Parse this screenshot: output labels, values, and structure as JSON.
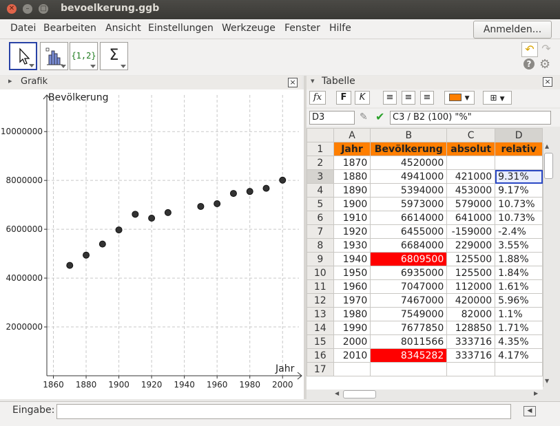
{
  "window": {
    "title": "bevoelkerung.ggb"
  },
  "menu": [
    "Datei",
    "Bearbeiten",
    "Ansicht",
    "Einstellungen",
    "Werkzeuge",
    "Fenster",
    "Hilfe"
  ],
  "login_label": "Anmelden...",
  "toolbar": {
    "list_tool_label": "{1,2}",
    "sum_tool_label": "Σ"
  },
  "graphics_panel": {
    "title": "Grafik"
  },
  "spreadsheet_panel": {
    "title": "Tabelle",
    "fx_label": "fx",
    "bold_label": "F",
    "italic_label": "K",
    "cell_name": "D3",
    "formula": "C3 / B2 (100) \"%\"",
    "columns": [
      "A",
      "B",
      "C",
      "D"
    ],
    "rows": [
      [
        "1",
        "Jahr",
        "Bevölkerung",
        "absolut",
        "relativ"
      ],
      [
        "2",
        "1870",
        "4520000",
        "",
        ""
      ],
      [
        "3",
        "1880",
        "4941000",
        "421000",
        "9.31%"
      ],
      [
        "4",
        "1890",
        "5394000",
        "453000",
        "9.17%"
      ],
      [
        "5",
        "1900",
        "5973000",
        "579000",
        "10.73%"
      ],
      [
        "6",
        "1910",
        "6614000",
        "641000",
        "10.73%"
      ],
      [
        "7",
        "1920",
        "6455000",
        "-159000",
        "-2.4%"
      ],
      [
        "8",
        "1930",
        "6684000",
        "229000",
        "3.55%"
      ],
      [
        "9",
        "1940",
        "6809500",
        "125500",
        "1.88%"
      ],
      [
        "10",
        "1950",
        "6935000",
        "125500",
        "1.84%"
      ],
      [
        "11",
        "1960",
        "7047000",
        "112000",
        "1.61%"
      ],
      [
        "12",
        "1970",
        "7467000",
        "420000",
        "5.96%"
      ],
      [
        "13",
        "1980",
        "7549000",
        "82000",
        "1.1%"
      ],
      [
        "14",
        "1990",
        "7677850",
        "128850",
        "1.71%"
      ],
      [
        "15",
        "2000",
        "8011566",
        "333716",
        "4.35%"
      ],
      [
        "16",
        "2010",
        "8345282",
        "333716",
        "4.17%"
      ],
      [
        "17",
        "",
        "",
        "",
        ""
      ]
    ],
    "selected_cell": "D3",
    "red_cells": [
      "B9",
      "B16"
    ]
  },
  "input_bar": {
    "label": "Eingabe:",
    "value": ""
  },
  "colors": {
    "header_orange": "#ff7f00",
    "highlight_red": "#ff0000",
    "selection_blue": "#2a48c4"
  },
  "chart_data": {
    "type": "scatter",
    "xlabel": "Jahr",
    "ylabel": "Bevölkerung",
    "x_ticks": [
      "1860",
      "1880",
      "1900",
      "1920",
      "1940",
      "1960",
      "1980",
      "2000"
    ],
    "y_ticks": [
      "2000000",
      "4000000",
      "6000000",
      "8000000",
      "10000000"
    ],
    "xlim": [
      1856,
      2010
    ],
    "ylim": [
      0,
      11500000
    ],
    "grid": true,
    "points": [
      [
        1870,
        4520000
      ],
      [
        1880,
        4941000
      ],
      [
        1890,
        5394000
      ],
      [
        1900,
        5973000
      ],
      [
        1910,
        6614000
      ],
      [
        1920,
        6455000
      ],
      [
        1930,
        6684000
      ],
      [
        1950,
        6935000
      ],
      [
        1960,
        7047000
      ],
      [
        1970,
        7467000
      ],
      [
        1980,
        7549000
      ],
      [
        1990,
        7677850
      ],
      [
        2000,
        8011566
      ]
    ]
  }
}
